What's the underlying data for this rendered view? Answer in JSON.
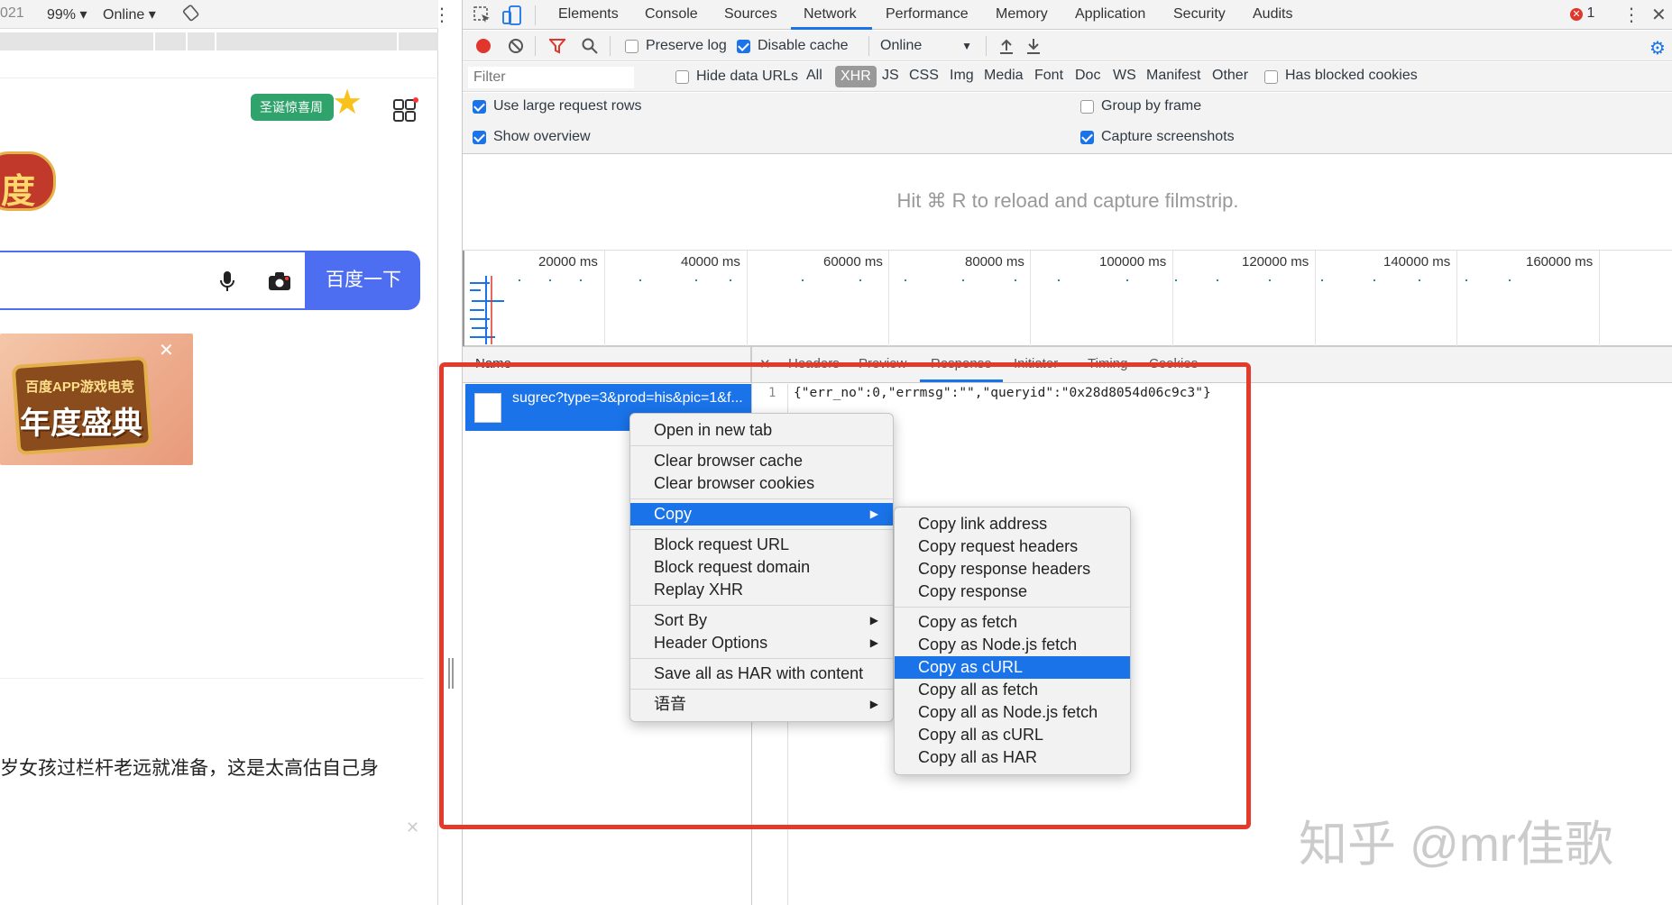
{
  "device_bar": {
    "year_fragment": "021",
    "zoom": "99%",
    "network": "Online"
  },
  "left_page": {
    "badge_text": "圣诞惊喜周",
    "search_button": "百度一下",
    "banner_text_1": "百度APP游戏电竞",
    "banner_text_2": "年度盛典",
    "news_text": "岁女孩过栏杆老远就准备，这是太高估自己身"
  },
  "devtools": {
    "tabs": [
      "Elements",
      "Console",
      "Sources",
      "Network",
      "Performance",
      "Memory",
      "Application",
      "Security",
      "Audits"
    ],
    "active_tab": "Network",
    "error_count": "1",
    "toolbar": {
      "preserve_log": "Preserve log",
      "disable_cache": "Disable cache",
      "throttle": "Online"
    },
    "filter": {
      "placeholder": "Filter",
      "hide_data_urls": "Hide data URLs",
      "types": [
        "All",
        "XHR",
        "JS",
        "CSS",
        "Img",
        "Media",
        "Font",
        "Doc",
        "WS",
        "Manifest",
        "Other"
      ],
      "active_type": "XHR",
      "blocked_cookies": "Has blocked cookies"
    },
    "settings": {
      "large_rows": "Use large request rows",
      "group_by_frame": "Group by frame",
      "show_overview": "Show overview",
      "capture_screenshots": "Capture screenshots"
    },
    "filmstrip_hint": "Hit ⌘ R to reload and capture filmstrip.",
    "timeline_ticks": [
      "20000 ms",
      "40000 ms",
      "60000 ms",
      "80000 ms",
      "100000 ms",
      "120000 ms",
      "140000 ms",
      "160000 ms"
    ],
    "name_column": "Name",
    "detail_tabs": [
      "Headers",
      "Preview",
      "Response",
      "Initiator",
      "Timing",
      "Cookies"
    ],
    "active_detail_tab": "Response",
    "request_name": "sugrec?type=3&prod=his&pic=1&f...",
    "response_line_no": "1",
    "response_body": "{\"err_no\":0,\"errmsg\":\"\",\"queryid\":\"0x28d8054d06c9c3\"}"
  },
  "context_menu": {
    "groups": [
      [
        "Open in new tab"
      ],
      [
        "Clear browser cache",
        "Clear browser cookies"
      ],
      [
        "Copy"
      ],
      [
        "Block request URL",
        "Block request domain",
        "Replay XHR"
      ],
      [
        "Sort By",
        "Header Options"
      ],
      [
        "Save all as HAR with content"
      ],
      [
        "语音"
      ]
    ],
    "submenu_items": [
      "Copy",
      "Sort By",
      "Header Options",
      "语音"
    ],
    "selected": "Copy"
  },
  "copy_submenu": {
    "groups": [
      [
        "Copy link address",
        "Copy request headers",
        "Copy response headers",
        "Copy response"
      ],
      [
        "Copy as fetch",
        "Copy as Node.js fetch",
        "Copy as cURL",
        "Copy all as fetch",
        "Copy all as Node.js fetch",
        "Copy all as cURL",
        "Copy all as HAR"
      ]
    ],
    "selected": "Copy as cURL"
  },
  "watermark": "知乎 @mr佳歌",
  "colors": {
    "accent": "#1a73e8",
    "highlight_border": "#e43a2c",
    "search_button_bg": "#4e6ef2"
  }
}
